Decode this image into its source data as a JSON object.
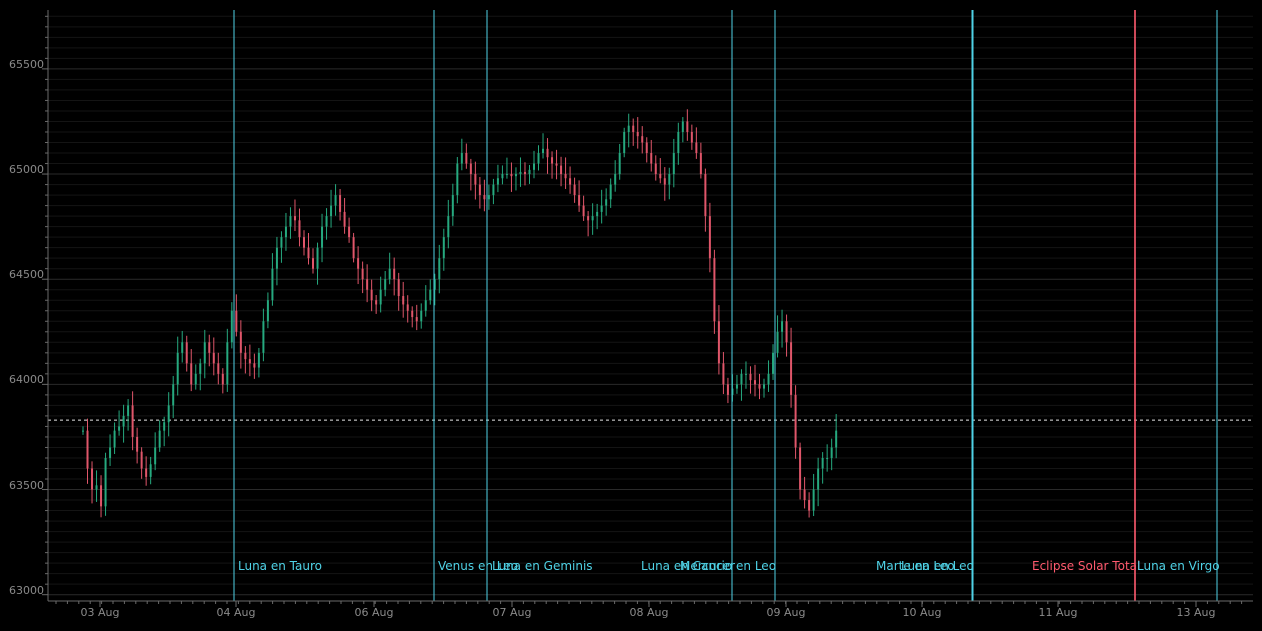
{
  "colors": {
    "background": "#000000",
    "grid_major": "#2a2a2a",
    "grid_minor": "#141414",
    "axis": "#6a6a6a",
    "up": "#26a97f",
    "down": "#e0566a",
    "event_cyan": "#4fd2e6",
    "event_red": "#ff5a6e",
    "reference_line": "#e6e6e6"
  },
  "chart_data": {
    "type": "candlestick",
    "title": "",
    "xlabel": "",
    "ylabel": "",
    "ylim": [
      62970,
      65780
    ],
    "y_ticks": [
      63000,
      63500,
      64000,
      64500,
      65000,
      65500
    ],
    "x_ticks": [
      "03 Aug",
      "04 Aug",
      "06 Aug",
      "07 Aug",
      "08 Aug",
      "09 Aug",
      "10 Aug",
      "11 Aug",
      "13 Aug"
    ],
    "reference_price": 63830,
    "grid": true,
    "events": [
      {
        "label": "Luna en Tauro",
        "color": "cyan"
      },
      {
        "label": "Venus en Leo",
        "color": "cyan"
      },
      {
        "label": "Luna en Geminis",
        "color": "cyan"
      },
      {
        "label": "Luna en Cancer",
        "color": "cyan"
      },
      {
        "label": "Mercurio en Leo",
        "color": "cyan"
      },
      {
        "label": "Marte en Leo",
        "color": "cyan"
      },
      {
        "label": "Luna en Leo",
        "color": "cyan"
      },
      {
        "label": "Eclipse Solar Total",
        "color": "red"
      },
      {
        "label": "Luna en Virgo",
        "color": "cyan"
      }
    ],
    "close_path": [
      63780,
      63600,
      63500,
      63520,
      63420,
      63650,
      63700,
      63780,
      63800,
      63850,
      63900,
      63750,
      63680,
      63600,
      63560,
      63620,
      63700,
      63780,
      63820,
      63900,
      64000,
      64150,
      64200,
      64100,
      64000,
      64050,
      64100,
      64200,
      64150,
      64100,
      64050,
      64000,
      64200,
      64350,
      64250,
      64150,
      64120,
      64100,
      64080,
      64150,
      64300,
      64400,
      64550,
      64650,
      64700,
      64750,
      64800,
      64780,
      64700,
      64650,
      64600,
      64550,
      64650,
      64750,
      64800,
      64850,
      64900,
      64820,
      64750,
      64700,
      64600,
      64550,
      64500,
      64450,
      64400,
      64380,
      64450,
      64500,
      64550,
      64500,
      64420,
      64380,
      64350,
      64320,
      64300,
      64350,
      64400,
      64450,
      64500,
      64600,
      64700,
      64800,
      64900,
      65050,
      65100,
      65050,
      65000,
      64950,
      64900,
      64880,
      64900,
      64950,
      64980,
      65000,
      65000,
      64990,
      65000,
      65010,
      65000,
      65020,
      65050,
      65100,
      65120,
      65080,
      65050,
      65040,
      65000,
      64980,
      64950,
      64900,
      64850,
      64800,
      64780,
      64800,
      64820,
      64850,
      64880,
      64950,
      65000,
      65100,
      65200,
      65230,
      65200,
      65180,
      65150,
      65100,
      65050,
      65000,
      64980,
      64950,
      65000,
      65100,
      65200,
      65250,
      65200,
      65150,
      65100,
      65000,
      64800,
      64600,
      64300,
      64100,
      64000,
      63950,
      63980,
      64000,
      64050,
      64050,
      64020,
      64000,
      63980,
      64000,
      64050,
      64150,
      64250,
      64300,
      64200,
      63950,
      63700,
      63500,
      63450,
      63400,
      63500,
      63600,
      63650,
      63650,
      63700,
      63780
    ]
  }
}
